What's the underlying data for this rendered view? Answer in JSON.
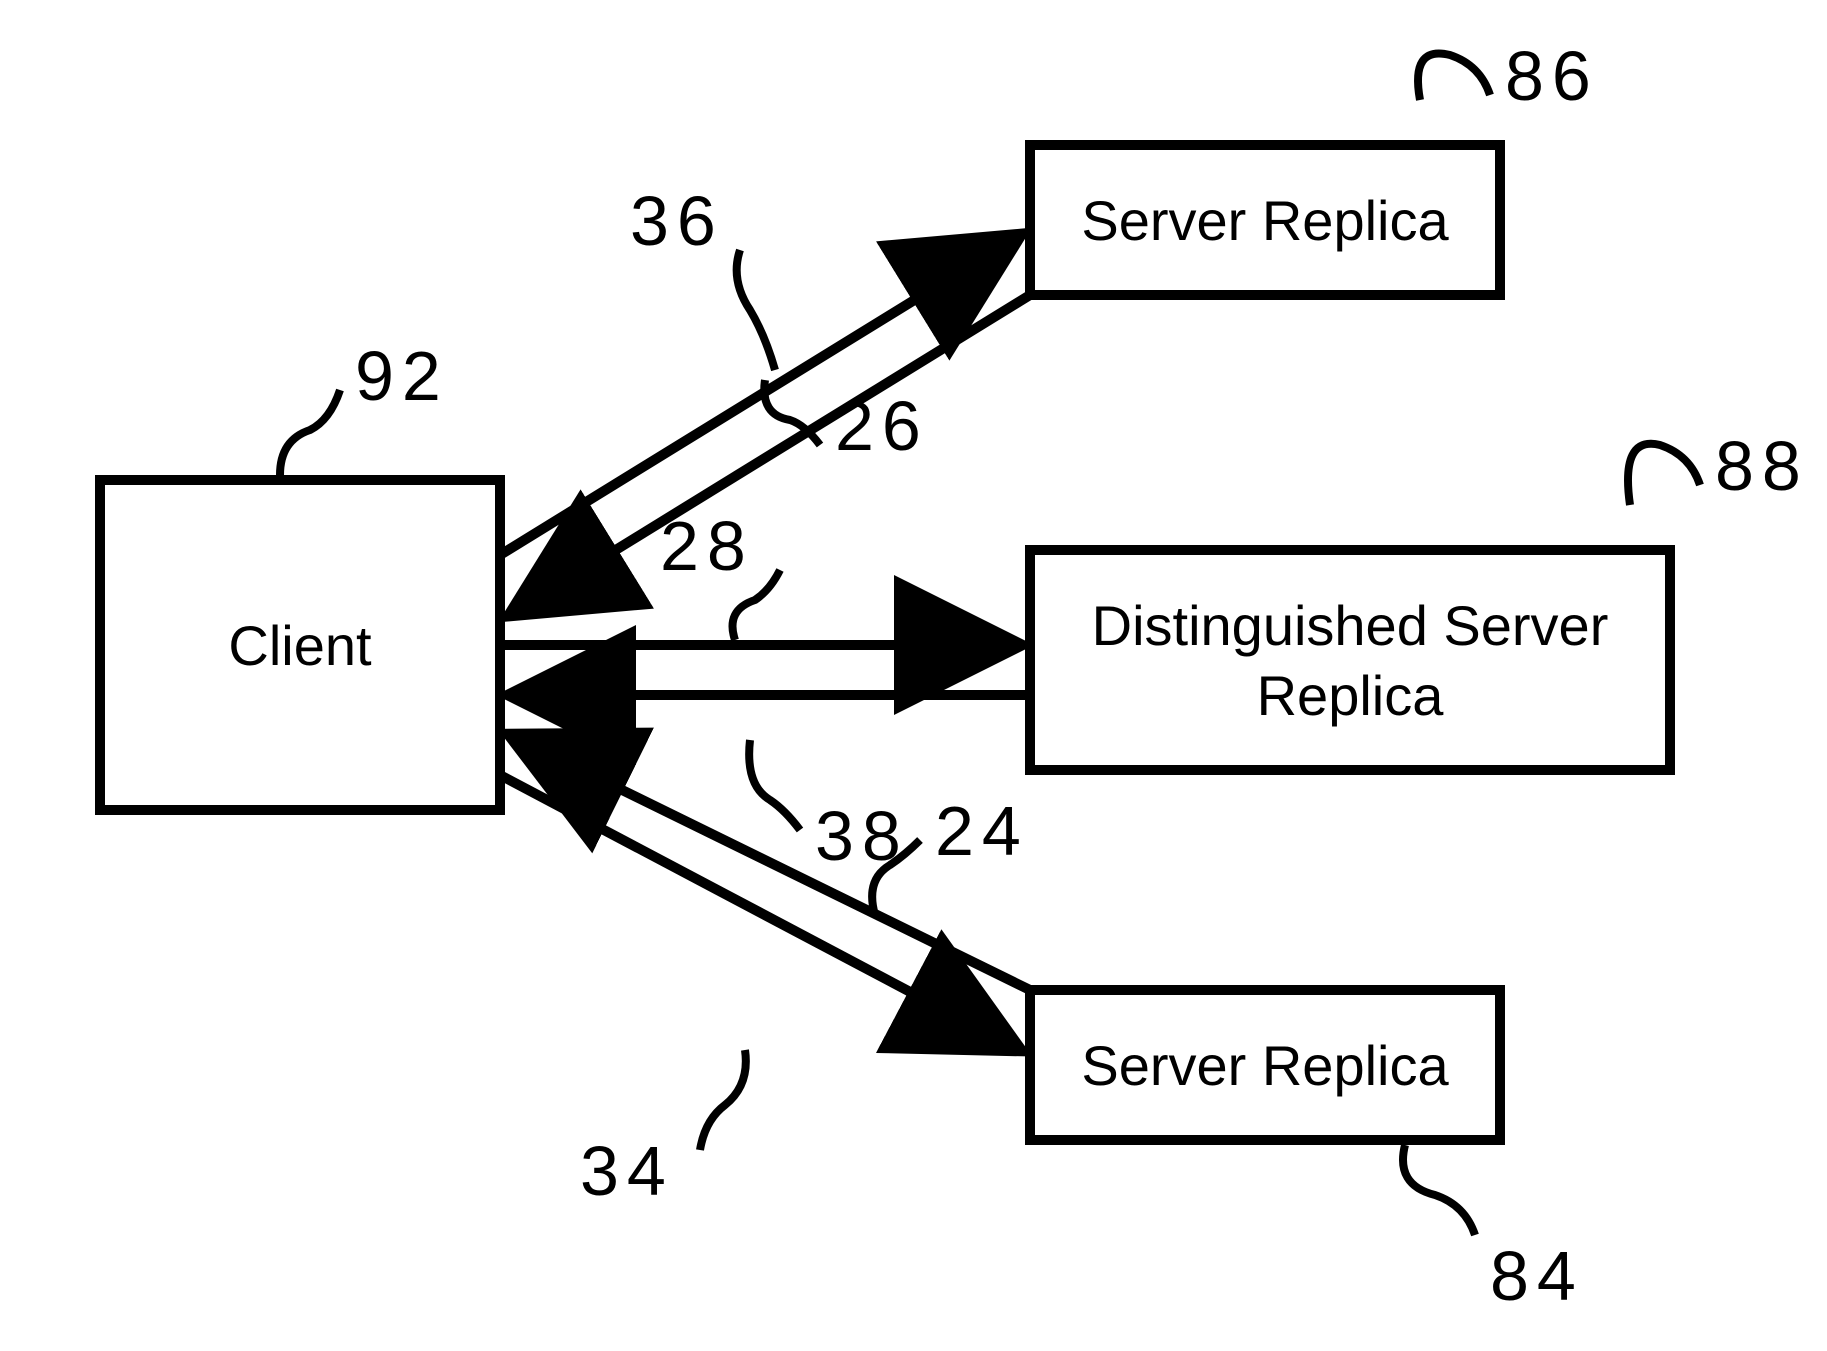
{
  "boxes": {
    "client": {
      "label": "Client",
      "ref": "92"
    },
    "server1": {
      "label": "Server Replica",
      "ref": "86"
    },
    "server2": {
      "line1": "Distinguished Server",
      "line2": "Replica",
      "ref": "88"
    },
    "server3": {
      "label": "Server Replica",
      "ref": "84"
    }
  },
  "arrows": {
    "to_s1": "36",
    "from_s1": "26",
    "to_s2": "28",
    "from_s2": "38",
    "to_s3": "24",
    "from_s3": "34"
  }
}
